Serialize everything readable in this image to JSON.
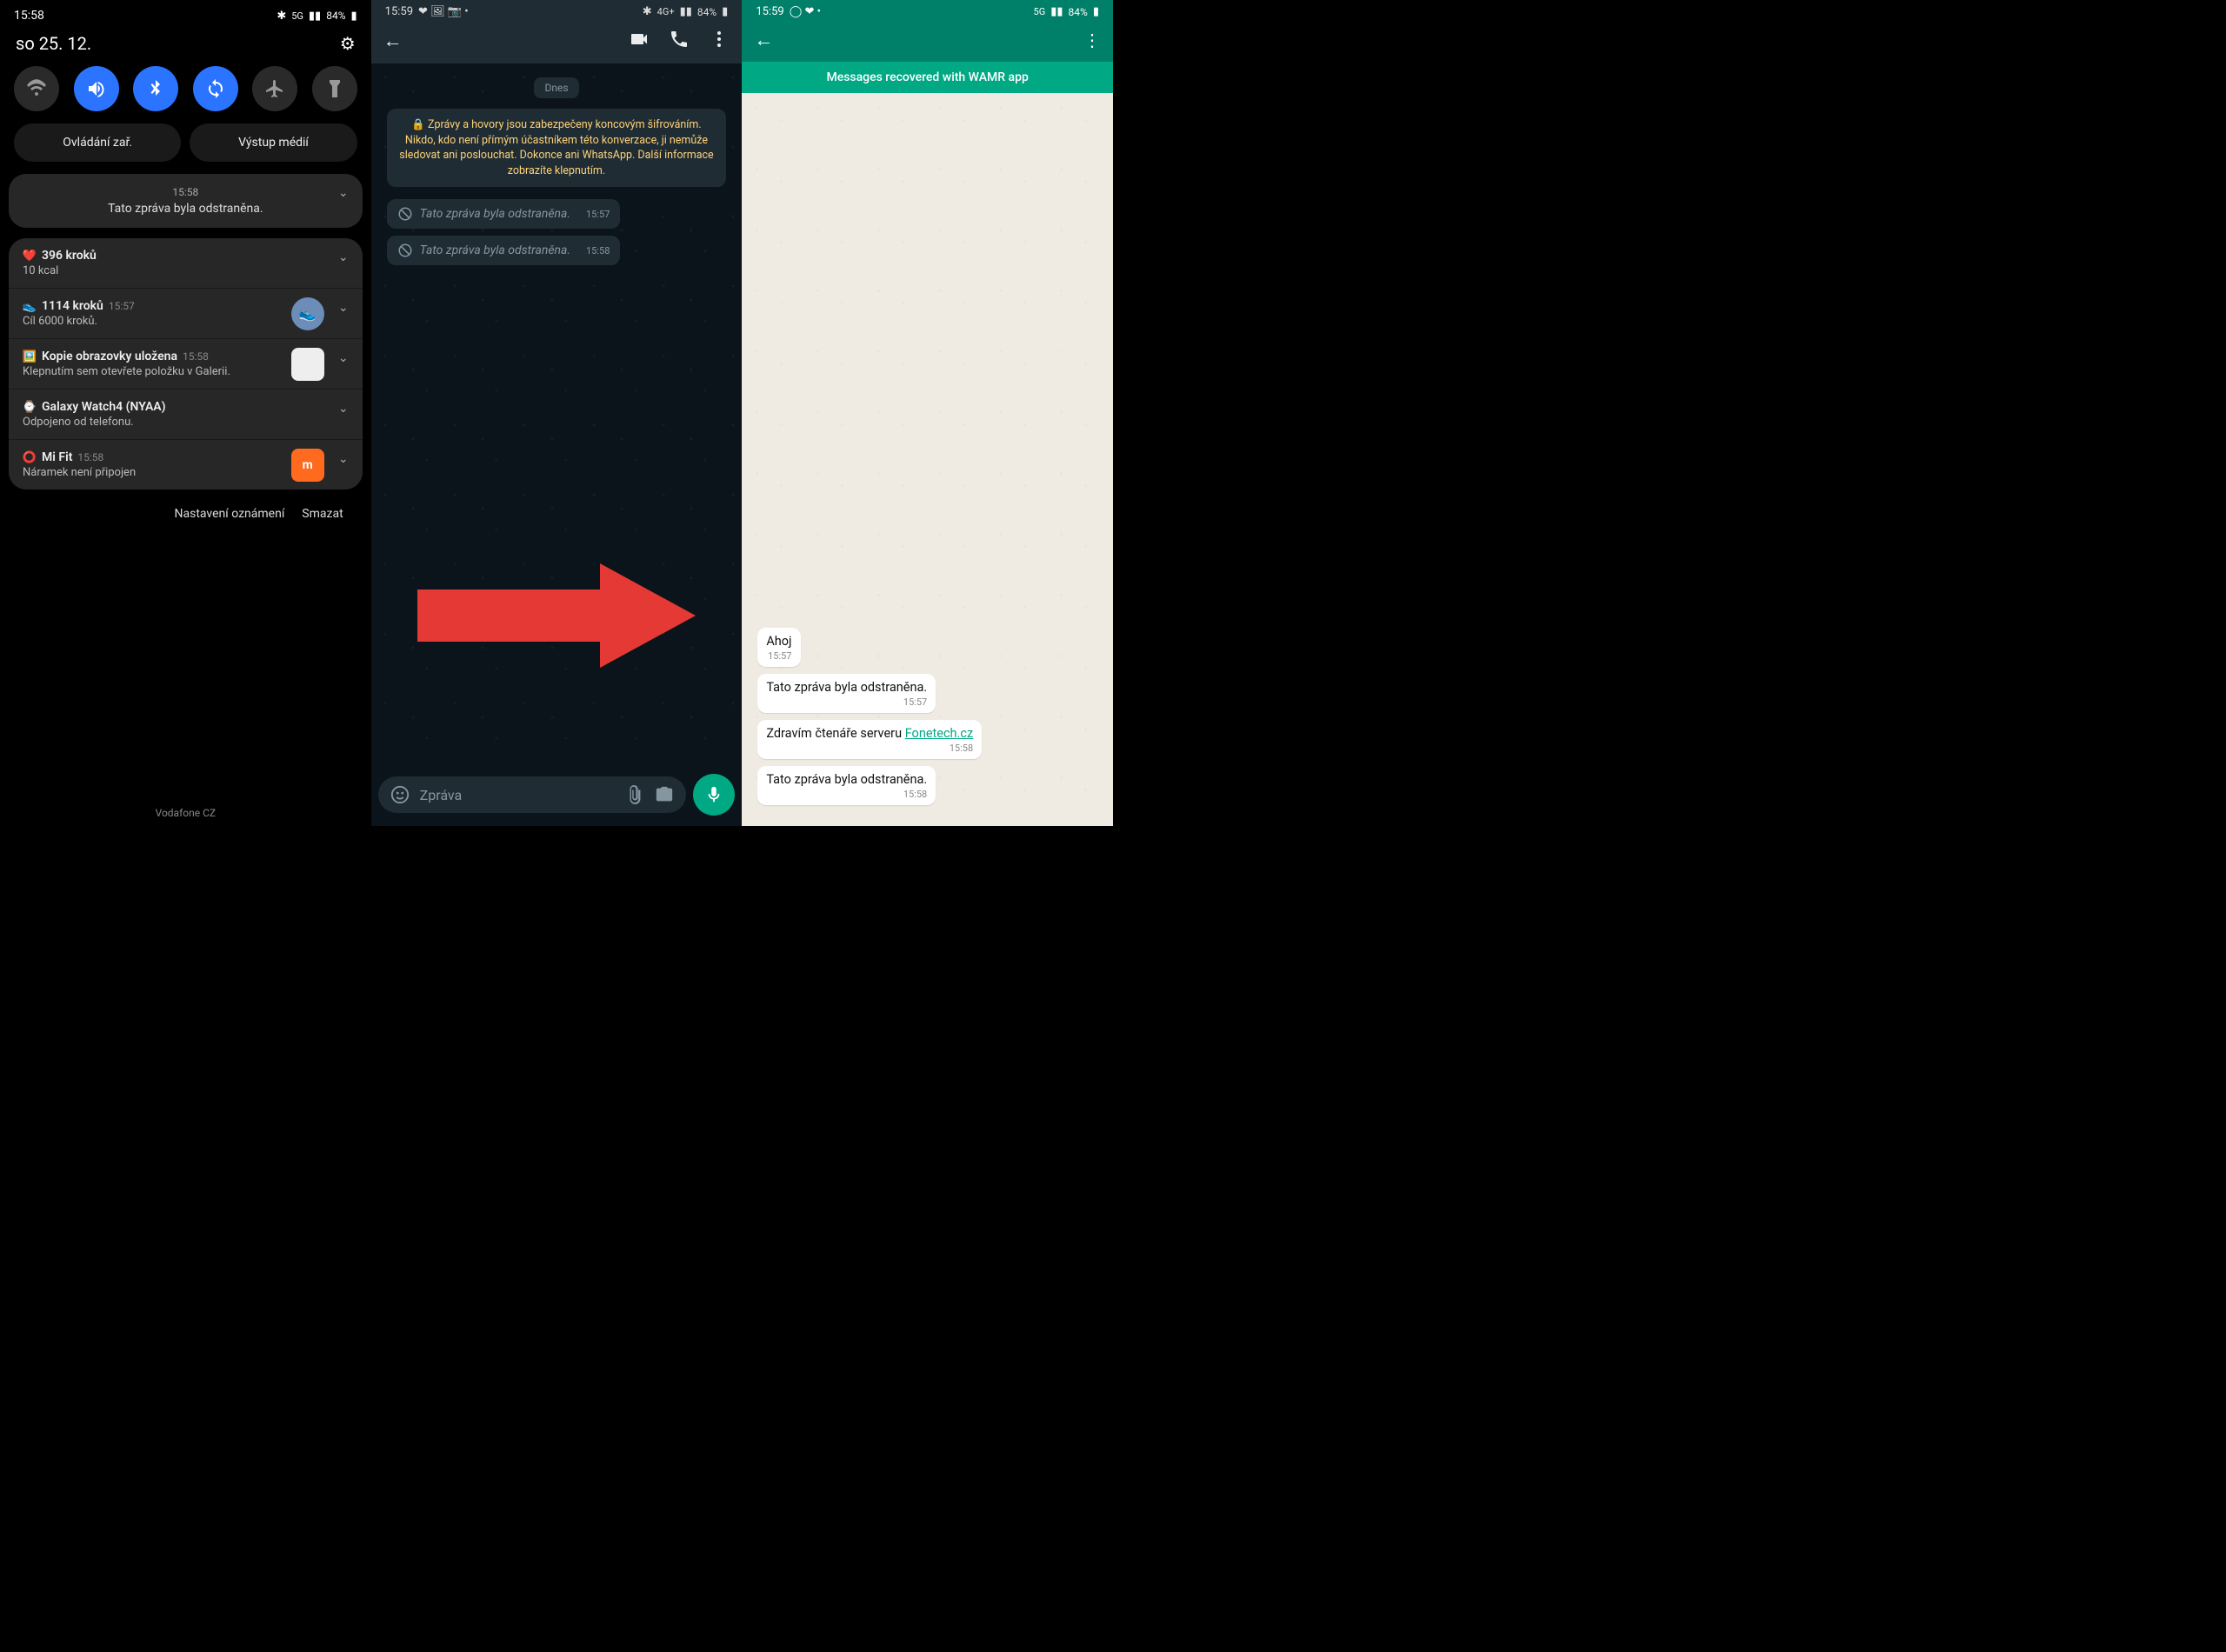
{
  "panel1": {
    "status_time": "15:58",
    "status_net": "5G",
    "status_batt": "84%",
    "date": "so 25. 12.",
    "pills": {
      "left": "Ovládání zař.",
      "right": "Výstup médií"
    },
    "notif_deleted": {
      "time": "15:58",
      "text": "Tato zpráva byla odstraněna."
    },
    "group": [
      {
        "icon": "❤️",
        "title": "396 kroků",
        "sub": "10 kcal",
        "time": ""
      },
      {
        "icon": "👟",
        "title": "1114 kroků",
        "sub": "Cíl 6000 kroků.",
        "time": "15:57",
        "thumb": "blue"
      },
      {
        "icon": "🖼️",
        "title": "Kopie obrazovky uložena",
        "sub": "Klepnutím sem otevřete položku v Galerii.",
        "time": "15:58",
        "thumb": "white"
      },
      {
        "icon": "⌚",
        "title": "Galaxy Watch4 (NYAA)",
        "sub": "Odpojeno od telefonu.",
        "time": ""
      },
      {
        "icon": "⭕",
        "title": "Mi Fit",
        "sub": "Náramek není připojen",
        "time": "15:58",
        "thumb": "orange"
      }
    ],
    "actions": {
      "settings": "Nastavení oznámení",
      "clear": "Smazat"
    },
    "carrier": "Vodafone CZ"
  },
  "panel2": {
    "status_time": "15:59",
    "status_net": "4G+",
    "status_batt": "84%",
    "date_chip": "Dnes",
    "encryption": "🔒 Zprávy a hovory jsou zabezpečeny koncovým šifrováním. Nikdo, kdo není přímým účastníkem této konverzace, ji nemůže sledovat ani poslouchat. Dokonce ani WhatsApp. Další informace zobrazíte klepnutím.",
    "deleted": [
      {
        "text": "Tato zpráva byla odstraněna.",
        "time": "15:57"
      },
      {
        "text": "Tato zpráva byla odstraněna.",
        "time": "15:58"
      }
    ],
    "input_placeholder": "Zpráva"
  },
  "panel3": {
    "status_time": "15:59",
    "status_net": "5G",
    "status_batt": "84%",
    "banner": "Messages recovered with WAMR app",
    "messages": [
      {
        "text": "Ahoj",
        "time": "15:57"
      },
      {
        "text": "Tato zpráva byla odstraněna.",
        "time": "15:57"
      },
      {
        "text_pre": "Zdravím čtenáře serveru ",
        "link": "Fonetech.cz",
        "time": "15:58"
      },
      {
        "text": "Tato zpráva byla odstraněna.",
        "time": "15:58"
      }
    ]
  }
}
